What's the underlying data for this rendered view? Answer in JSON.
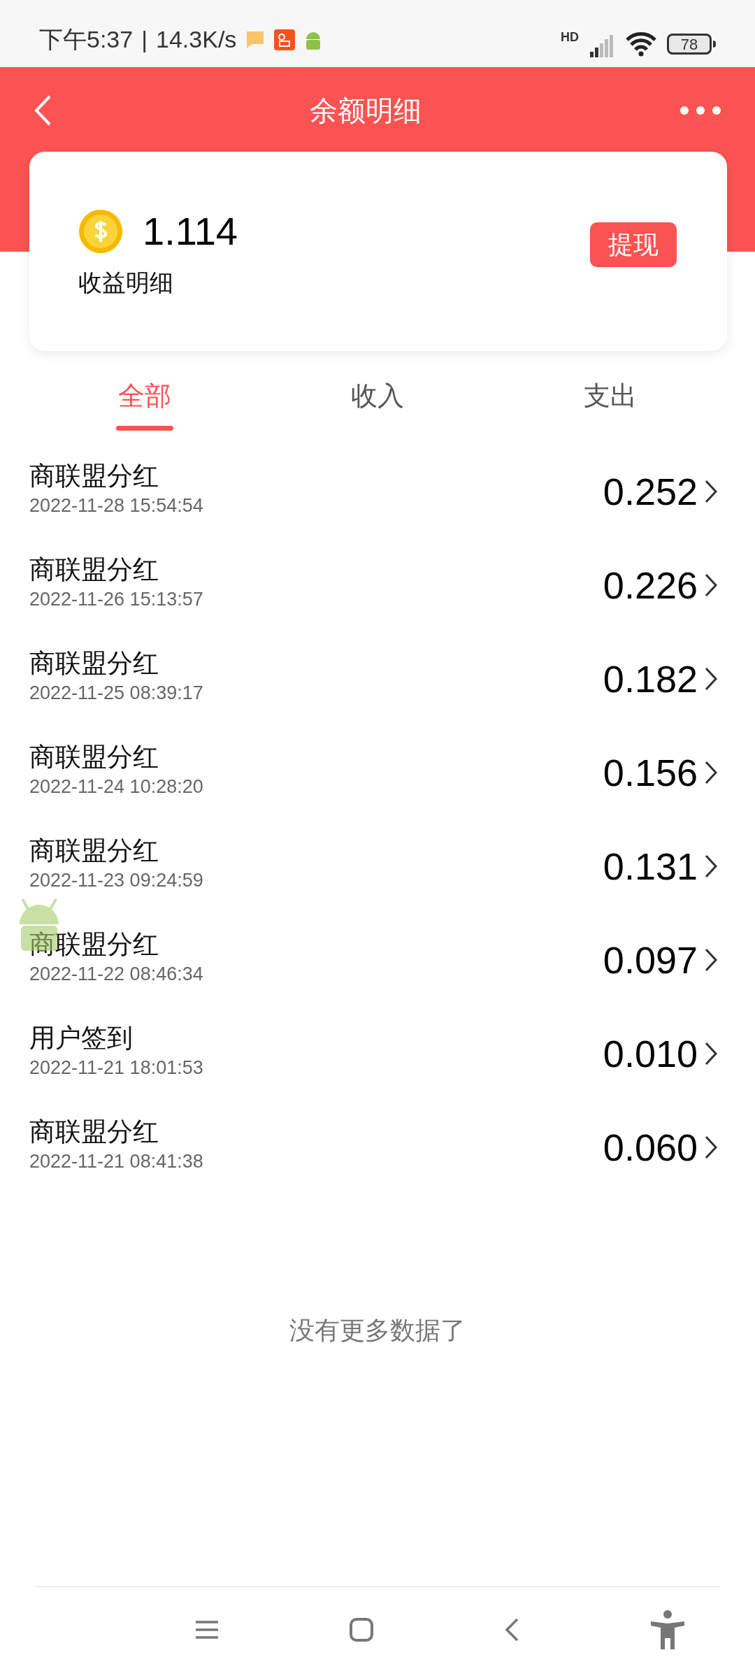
{
  "status_bar": {
    "time": "下午5:37",
    "separator": "|",
    "speed": "14.3K/s",
    "network": "HD",
    "battery": "78"
  },
  "header": {
    "title": "余额明细"
  },
  "balance_card": {
    "amount": "1.114",
    "label": "收益明细",
    "button": "提现"
  },
  "tabs": [
    {
      "label": "全部",
      "selected": true
    },
    {
      "label": "收入",
      "selected": false
    },
    {
      "label": "支出",
      "selected": false
    }
  ],
  "records": [
    {
      "title": "商联盟分红",
      "time": "2022-11-28 15:54:54",
      "amount": "0.252"
    },
    {
      "title": "商联盟分红",
      "time": "2022-11-26 15:13:57",
      "amount": "0.226"
    },
    {
      "title": "商联盟分红",
      "time": "2022-11-25 08:39:17",
      "amount": "0.182"
    },
    {
      "title": "商联盟分红",
      "time": "2022-11-24 10:28:20",
      "amount": "0.156"
    },
    {
      "title": "商联盟分红",
      "time": "2022-11-23 09:24:59",
      "amount": "0.131"
    },
    {
      "title": "商联盟分红",
      "time": "2022-11-22 08:46:34",
      "amount": "0.097"
    },
    {
      "title": "用户签到",
      "time": "2022-11-21 18:01:53",
      "amount": "0.010"
    },
    {
      "title": "商联盟分红",
      "time": "2022-11-21 08:41:38",
      "amount": "0.060"
    }
  ],
  "footer_note": "没有更多数据了"
}
